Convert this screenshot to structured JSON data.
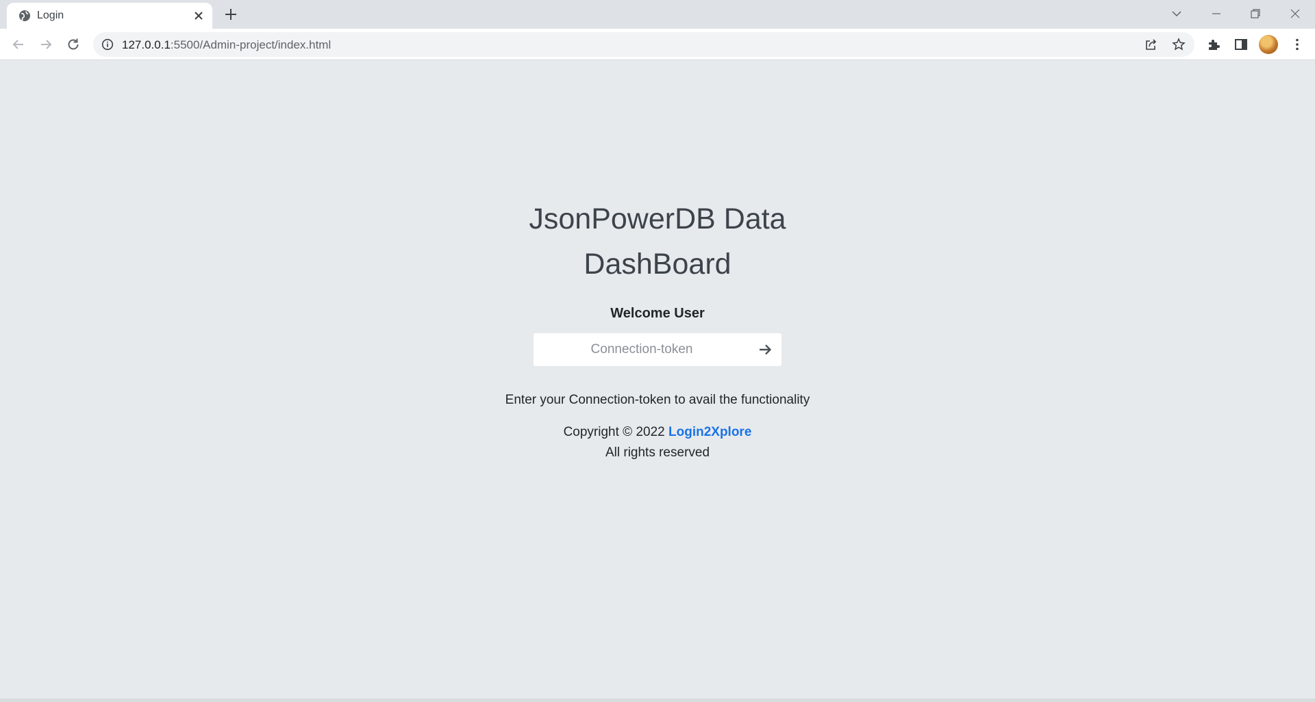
{
  "browser": {
    "tab_title": "Login",
    "url_host": "127.0.0.1",
    "url_path": ":5500/Admin-project/index.html"
  },
  "page": {
    "title_line1": "JsonPowerDB Data",
    "title_line2": "DashBoard",
    "welcome": "Welcome User",
    "token_placeholder": "Connection-token",
    "token_value": "",
    "hint": "Enter your Connection-token to avail the functionality",
    "copyright_prefix": "Copyright © 2022",
    "brand_link": "Login2Xplore",
    "rights": "All rights reserved"
  },
  "icons": {
    "tab_favicon": "globe-icon",
    "tab_close": "close-icon",
    "new_tab": "plus-icon",
    "back": "back-arrow-icon",
    "forward": "forward-arrow-icon",
    "reload": "reload-icon",
    "site_info": "info-icon",
    "share": "share-icon",
    "bookmark": "star-icon",
    "extensions": "puzzle-icon",
    "side_panel": "side-panel-icon",
    "menu": "kebab-menu-icon",
    "submit": "arrow-right-icon"
  },
  "colors": {
    "page_background": "#e7eaed",
    "link": "#1a73e8",
    "title": "#3d434b"
  }
}
